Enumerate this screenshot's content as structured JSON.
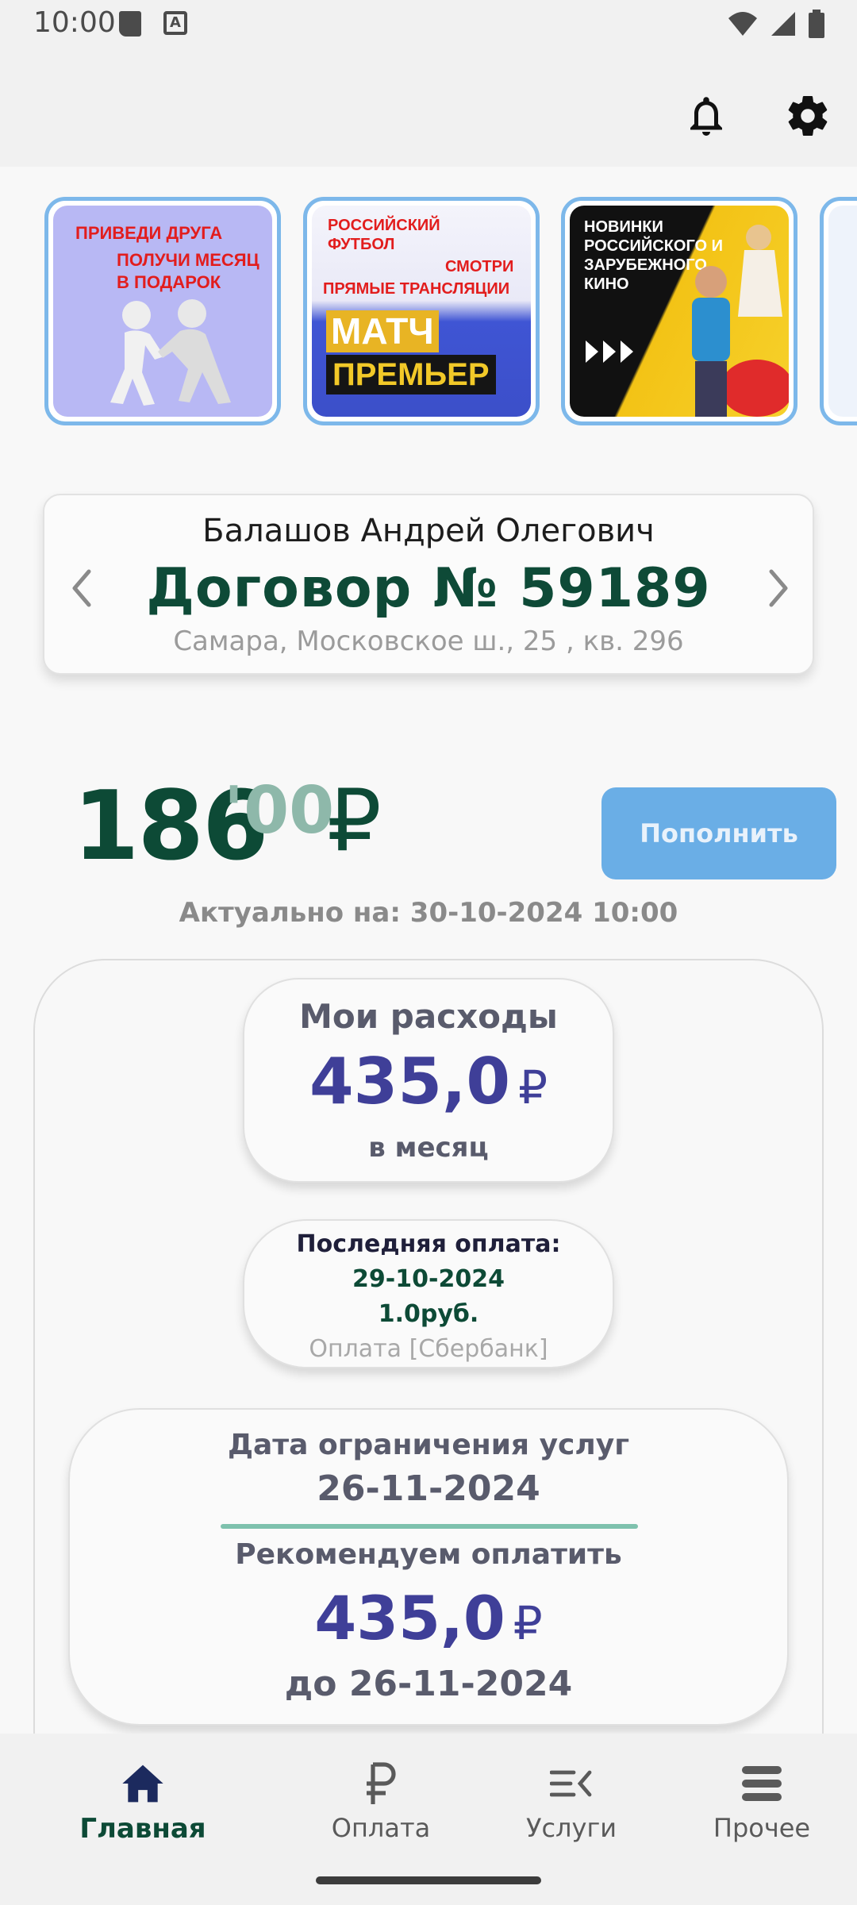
{
  "status_bar": {
    "time": "10:00",
    "icons": [
      "sd-card-icon",
      "a-notification-icon",
      "wifi-icon",
      "signal-icon",
      "battery-icon"
    ]
  },
  "app_bar": {
    "icons": [
      "bell-icon",
      "gear-icon"
    ]
  },
  "banners": [
    {
      "line1": "ПРИВЕДИ ДРУГА",
      "line2": "ПОЛУЧИ МЕСЯЦ",
      "line3": "В ПОДАРОК"
    },
    {
      "line1": "РОССИЙСКИЙ",
      "line2": "ФУТБОЛ",
      "line3": "СМОТРИ",
      "line4": "ПРЯМЫЕ ТРАНСЛЯЦИИ",
      "logo1": "МАТЧ",
      "logo2": "ПРЕМЬЕР"
    },
    {
      "line1": "НОВИНКИ",
      "line2": "РОССИЙСКОГО И",
      "line3": "ЗАРУБЕЖНОГО",
      "line4": "КИНО"
    }
  ],
  "contract": {
    "name": "Балашов Андрей Олегович",
    "label": "Договор",
    "number_sign": "№",
    "number": "59189",
    "address": "Самара, Московское ш., 25 , кв. 296"
  },
  "balance": {
    "integer": "186",
    "cents": "'00",
    "currency": "₽",
    "topup_label": "Пополнить",
    "actual": "Актуально на: 30-10-2024 10:00"
  },
  "expenses": {
    "title": "Мои расходы",
    "value": "435,0",
    "currency": "₽",
    "period": "в месяц"
  },
  "last_payment": {
    "title": "Последняя оплата:",
    "date": "29-10-2024",
    "amount": "1.0руб.",
    "method": "Оплата [Сбербанк]"
  },
  "limit": {
    "title": "Дата ограничения услуг",
    "date": "26-11-2024",
    "recommend": "Рекомендуем оплатить",
    "value": "435,0",
    "currency": "₽",
    "until": "до 26-11-2024"
  },
  "nav": [
    {
      "label": "Главная",
      "icon": "home-icon",
      "active": true
    },
    {
      "label": "Оплата",
      "icon": "ruble-icon",
      "active": false
    },
    {
      "label": "Услуги",
      "icon": "services-icon",
      "active": false
    },
    {
      "label": "Прочее",
      "icon": "menu-icon",
      "active": false
    }
  ],
  "colors": {
    "primary": "#0d4a36",
    "accent": "#3f3f98",
    "button": "#6aaee6",
    "banner_border": "#7db8ea"
  }
}
